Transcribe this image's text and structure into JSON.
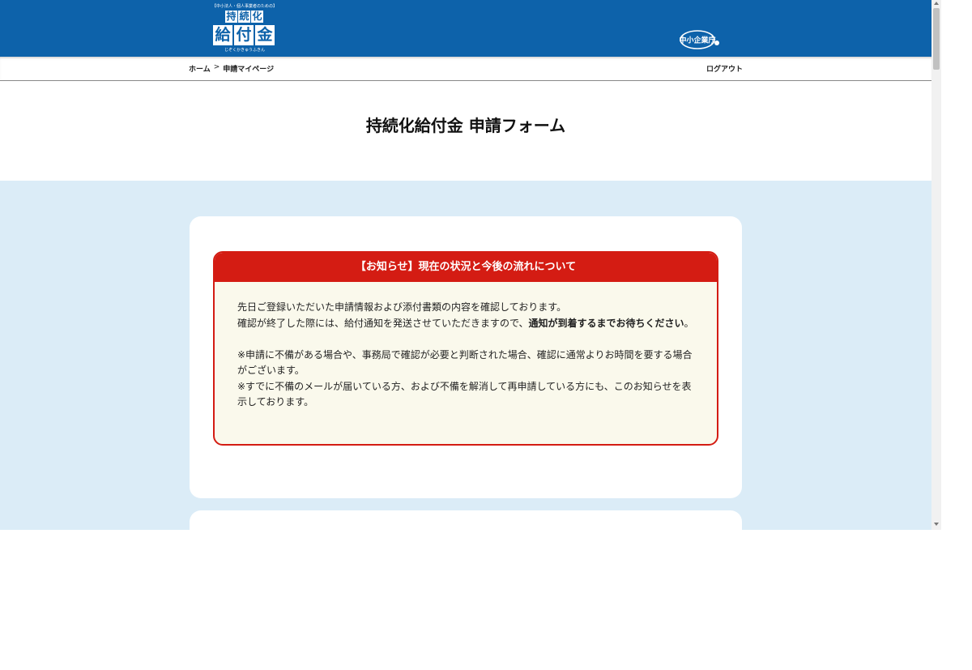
{
  "header": {
    "logo": {
      "tagline": "【中小法人・個人事業者のための】",
      "row1": [
        "持",
        "続",
        "化"
      ],
      "row2": [
        "給",
        "付",
        "金"
      ],
      "reading": "じぞくかきゅうふきん"
    },
    "agency_logo_text": "中小企業庁"
  },
  "nav": {
    "breadcrumb": {
      "home": "ホーム",
      "separator": ">",
      "current": "申請マイページ"
    },
    "logout": "ログアウト"
  },
  "page": {
    "title": "持続化給付金 申請フォーム"
  },
  "notice": {
    "heading": "【お知らせ】現在の状況と今後の流れについて",
    "line1": "先日ご登録いただいた申請情報および添付書類の内容を確認しております。",
    "line2_plain": "確認が終了した際には、給付通知を発送させていただきますので、",
    "line2_bold": "通知が到着するまでお待ちください",
    "line2_end": "。",
    "note1": "※申請に不備がある場合や、事務局で確認が必要と判断された場合、確認に通常よりお時間を要する場合がございます。",
    "note2": "※すでに不備のメールが届いている方、および不備を解消して再申請している方にも、このお知らせを表示しております。"
  },
  "colors": {
    "header_blue": "#0d62aa",
    "page_bg_blue": "#dbecf7",
    "notice_red": "#d41c13",
    "notice_bg": "#faf9ec"
  }
}
